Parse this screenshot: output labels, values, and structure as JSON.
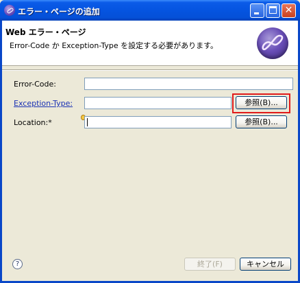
{
  "window": {
    "title": "エラー・ページの追加"
  },
  "titlebar_buttons": {
    "minimize": "",
    "maximize": "",
    "close": "✕"
  },
  "banner": {
    "title": "Web エラー・ページ",
    "message": "Error-Code か Exception-Type を設定する必要があります。"
  },
  "form": {
    "error_code": {
      "label": "Error-Code:",
      "value": ""
    },
    "exception_type": {
      "label": "Exception-Type:",
      "value": "",
      "browse_label": "参照(B)..."
    },
    "location": {
      "label": "Location:*",
      "value": "",
      "browse_label": "参照(B)..."
    }
  },
  "footer": {
    "help_icon": "?",
    "finish_label": "終了(F)",
    "finish_enabled": false,
    "cancel_label": "キャンセル"
  },
  "colors": {
    "title_bar": "#0554e0",
    "highlight": "#e11b1b",
    "link": "#1a31b4"
  },
  "icons": {
    "app": "eclipse-icon",
    "wizard": "eclipse-wizard-icon",
    "required": "required-field-icon",
    "help": "help-icon"
  }
}
